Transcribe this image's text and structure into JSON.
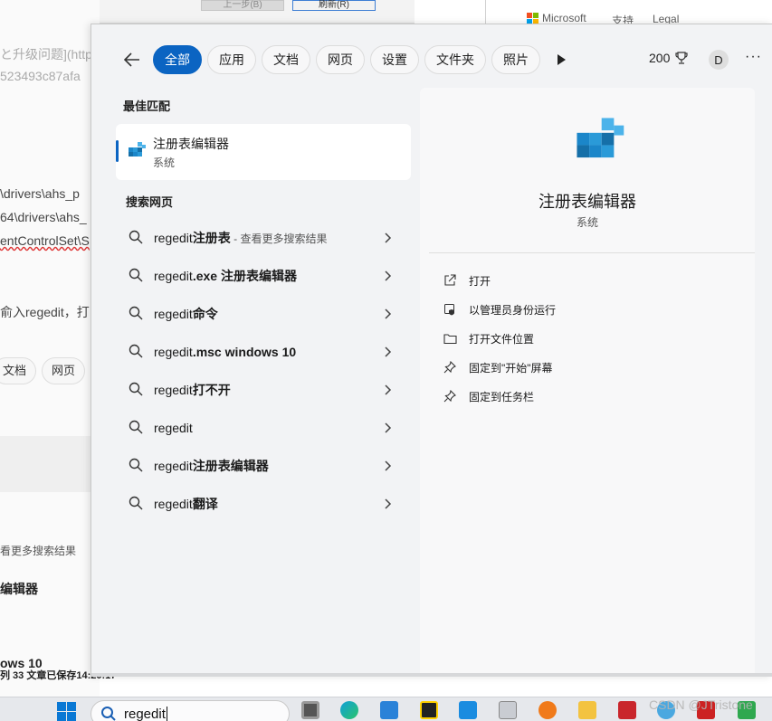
{
  "background": {
    "dialog_buttons": [
      "上一步(B)",
      "刷新(R)"
    ],
    "microsoft": "Microsoft",
    "links": [
      "支持",
      "Legal"
    ],
    "lines": [
      {
        "text": "と升级问题](http",
        "style": "gray"
      },
      {
        "text": "523493c87afa",
        "style": "gray"
      },
      {
        "text": "\\drivers\\ahs_p",
        "style": "normal"
      },
      {
        "text": "64\\drivers\\ahs_",
        "style": "normal"
      },
      {
        "text": "entControlSet\\S",
        "style": "red"
      },
      {
        "text": "俞入regedit，打",
        "style": "normal"
      }
    ],
    "chips": [
      "文档",
      "网页"
    ],
    "more_results": "看更多搜索结果",
    "bold_item": "编辑器",
    "windows10": "ows 10",
    "status": "列 33  文章已保存14:20:17"
  },
  "search": {
    "filters": [
      "全部",
      "应用",
      "文档",
      "网页",
      "设置",
      "文件夹",
      "照片"
    ],
    "points": "200",
    "avatar": "D",
    "more": "···",
    "best_match_heading": "最佳匹配",
    "best_match": {
      "name": "注册表编辑器",
      "type": "系统"
    },
    "web_heading": "搜索网页",
    "web_results": [
      {
        "prefix": "regedit",
        "bold": "注册表",
        "suffix": " - 查看更多搜索结果"
      },
      {
        "prefix": "regedit",
        "bold": ".exe 注册表编辑器",
        "suffix": ""
      },
      {
        "prefix": "regedit",
        "bold": "命令",
        "suffix": ""
      },
      {
        "prefix": "regedit",
        "bold": ".msc windows 10",
        "suffix": ""
      },
      {
        "prefix": "regedit",
        "bold": "打不开",
        "suffix": ""
      },
      {
        "prefix": "regedit",
        "bold": "",
        "suffix": ""
      },
      {
        "prefix": "regedit",
        "bold": "注册表编辑器",
        "suffix": ""
      },
      {
        "prefix": "regedit",
        "bold": "翻译",
        "suffix": ""
      }
    ],
    "detail": {
      "title": "注册表编辑器",
      "subtitle": "系统",
      "actions": [
        {
          "label": "打开",
          "icon": "open-external-icon"
        },
        {
          "label": "以管理员身份运行",
          "icon": "shield-admin-icon"
        },
        {
          "label": "打开文件位置",
          "icon": "folder-icon"
        },
        {
          "label": "固定到\"开始\"屏幕",
          "icon": "pin-icon"
        },
        {
          "label": "固定到任务栏",
          "icon": "pin-icon"
        }
      ]
    }
  },
  "taskbar": {
    "search_value": "regedit",
    "watermark": "CSDN @JTristone"
  }
}
